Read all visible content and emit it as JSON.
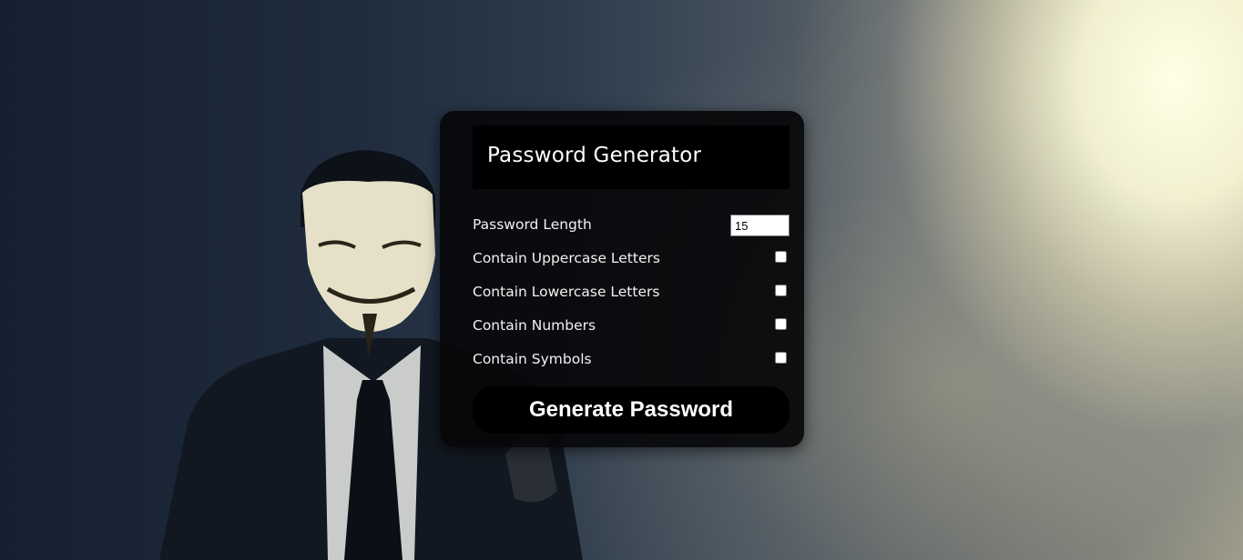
{
  "card": {
    "title": "Password Generator"
  },
  "options": {
    "length_label": "Password Length",
    "length_value": "15",
    "uppercase_label": "Contain Uppercase Letters",
    "lowercase_label": "Contain Lowercase Letters",
    "numbers_label": "Contain Numbers",
    "symbols_label": "Contain Symbols"
  },
  "actions": {
    "generate_label": "Generate Password"
  },
  "colors": {
    "card_background": "#08080a",
    "header_background": "#000000",
    "button_background": "#000000",
    "text": "#ffffff"
  },
  "icons": {
    "background_image": "masked-figure-in-smoke"
  }
}
